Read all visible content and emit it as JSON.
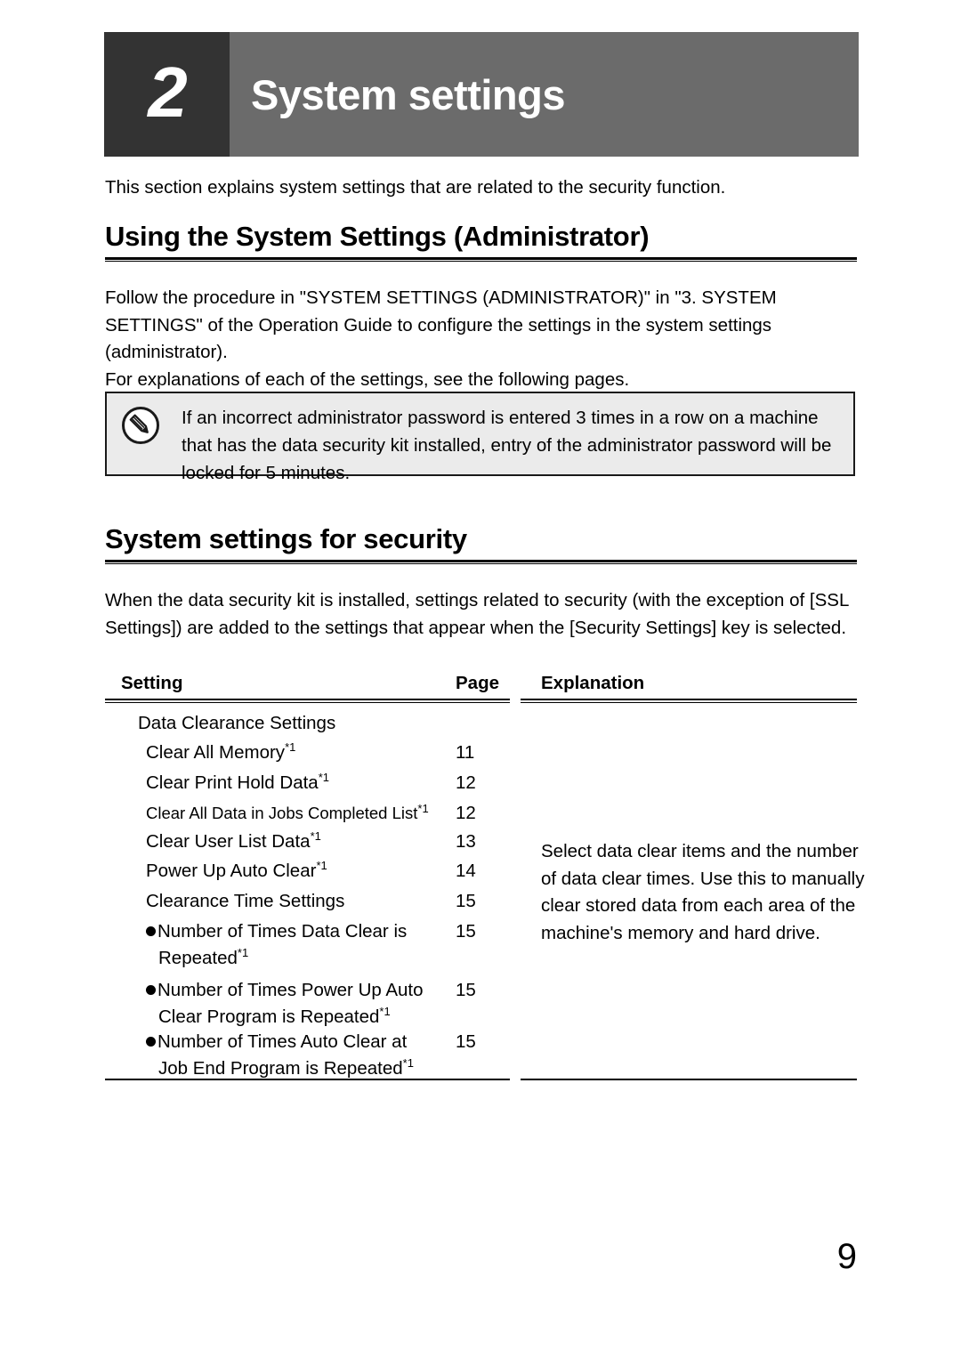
{
  "chapter": {
    "number": "2",
    "title": "System settings"
  },
  "intro": "This section explains system settings that are related to the security function.",
  "headings": {
    "admin": "Using the System Settings (Administrator)",
    "security": "System settings for security"
  },
  "paragraphs": {
    "follow": "Follow the procedure in \"SYSTEM SETTINGS (ADMINISTRATOR)\" in \"3. SYSTEM SETTINGS\" of the Operation Guide to configure the settings in the system settings (administrator).\nFor explanations of each of the settings, see the following pages.",
    "when": "When the data security kit is installed, settings related to security (with the exception of [SSL Settings]) are added to the settings that appear when the [Security Settings] key is selected."
  },
  "note": {
    "icon": "pencil-note-icon",
    "text": "If an incorrect administrator password is entered 3 times in a row on a machine that has the data security kit installed, entry of the administrator password will be locked for 5 minutes."
  },
  "table": {
    "headers": {
      "setting": "Setting",
      "page": "Page",
      "explanation": "Explanation"
    },
    "rows": [
      {
        "label": "Data Clearance Settings",
        "page": "",
        "indent": 1,
        "bullet": false,
        "small": false,
        "footnote": false
      },
      {
        "label": "Clear All Memory",
        "page": "11",
        "indent": 2,
        "bullet": false,
        "small": false,
        "footnote": true
      },
      {
        "label": "Clear Print Hold Data",
        "page": "12",
        "indent": 2,
        "bullet": false,
        "small": false,
        "footnote": true
      },
      {
        "label": "Clear All Data in Jobs Completed List",
        "page": "12",
        "indent": 2,
        "bullet": false,
        "small": true,
        "footnote": true
      },
      {
        "label": "Clear User List Data",
        "page": "13",
        "indent": 2,
        "bullet": false,
        "small": false,
        "footnote": true
      },
      {
        "label": "Power Up Auto Clear",
        "page": "14",
        "indent": 2,
        "bullet": false,
        "small": false,
        "footnote": true
      },
      {
        "label": "Clearance Time Settings",
        "page": "15",
        "indent": 2,
        "bullet": false,
        "small": false,
        "footnote": false
      },
      {
        "label": "Number of Times Data Clear is",
        "label2": "Repeated",
        "page": "15",
        "indent": 2,
        "bullet": true,
        "small": false,
        "footnote": true
      },
      {
        "label": "Number of Times Power Up Auto",
        "label2": "Clear Program is Repeated",
        "page": "15",
        "indent": 2,
        "bullet": true,
        "small": false,
        "footnote": true
      },
      {
        "label": "Number of Times Auto Clear at",
        "label2": "Job End Program is Repeated",
        "page": "15",
        "indent": 2,
        "bullet": true,
        "small": false,
        "footnote": true
      }
    ],
    "footnote_marker": "*1",
    "explanation": "Select data clear items and the number of data clear times. Use this to manually clear stored data from each area of the machine's memory and hard drive."
  },
  "page_number": "9",
  "colors": {
    "banner": "#6b6b6b",
    "chapter_block": "#333333",
    "note_background": "#ebebeb",
    "text": "#000000"
  }
}
